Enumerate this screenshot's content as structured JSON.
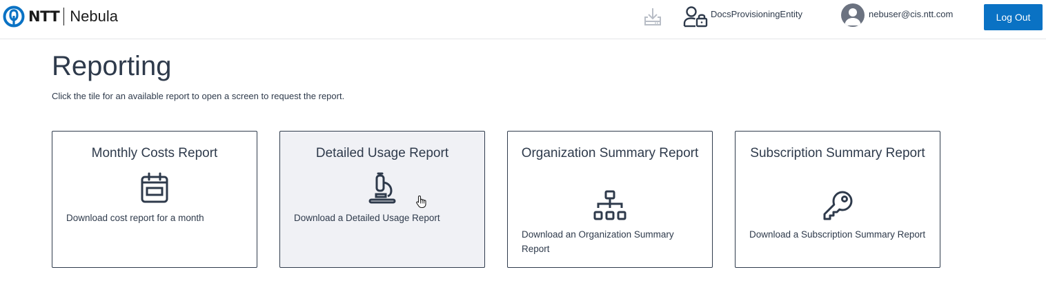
{
  "header": {
    "brand_ntt": "NTT",
    "brand_product": "Nebula",
    "download_icon": "download-tray-icon",
    "entity_icon": "person-lock-icon",
    "entity_name": "DocsProvisioningEntity",
    "avatar_icon": "user-avatar-icon",
    "user_email": "nebuser@cis.ntt.com",
    "logout_label": "Log Out"
  },
  "page": {
    "title": "Reporting",
    "subtitle": "Click the tile for an available report to open a screen to request the report."
  },
  "tiles": [
    {
      "title": "Monthly Costs Report",
      "icon": "calendar-icon",
      "description": "Download cost report for a month"
    },
    {
      "title": "Detailed Usage Report",
      "icon": "microscope-icon",
      "description": "Download a Detailed Usage Report"
    },
    {
      "title": "Organization Summary Report",
      "icon": "hierarchy-icon",
      "description": "Download an Organization Summary Report"
    },
    {
      "title": "Subscription Summary Report",
      "icon": "key-icon",
      "description": "Download a Subscription Summary Report"
    }
  ],
  "colors": {
    "primary": "#0a72c4",
    "text": "#2e3a4b",
    "tile_hover_bg": "#f0f1f5"
  }
}
